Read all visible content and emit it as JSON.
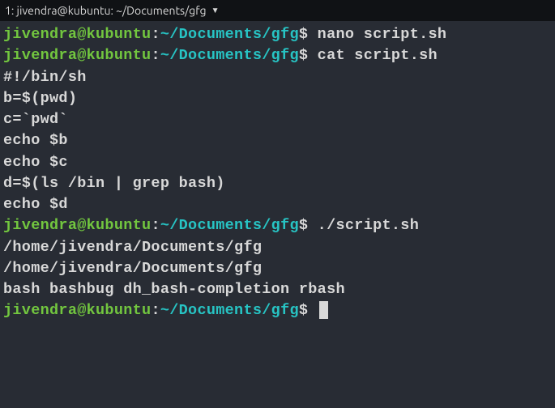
{
  "titlebar": {
    "text": "1: jivendra@kubuntu: ~/Documents/gfg",
    "dropdown_icon": "▼"
  },
  "prompt": {
    "user_host": "jivendra@kubuntu",
    "separator": ":",
    "path": "~/Documents/gfg",
    "symbol": "$"
  },
  "lines": {
    "cmd1": " nano script.sh",
    "cmd2": " cat script.sh",
    "out1": "#!/bin/sh",
    "out2": "b=$(pwd)",
    "out3": "c=`pwd`",
    "out4": "echo $b",
    "out5": "echo $c",
    "out6": "d=$(ls /bin | grep bash)",
    "out7": "echo $d",
    "cmd3": " ./script.sh",
    "out8": "/home/jivendra/Documents/gfg",
    "out9": "/home/jivendra/Documents/gfg",
    "out10": "bash bashbug dh_bash-completion rbash",
    "cmd4": " "
  }
}
